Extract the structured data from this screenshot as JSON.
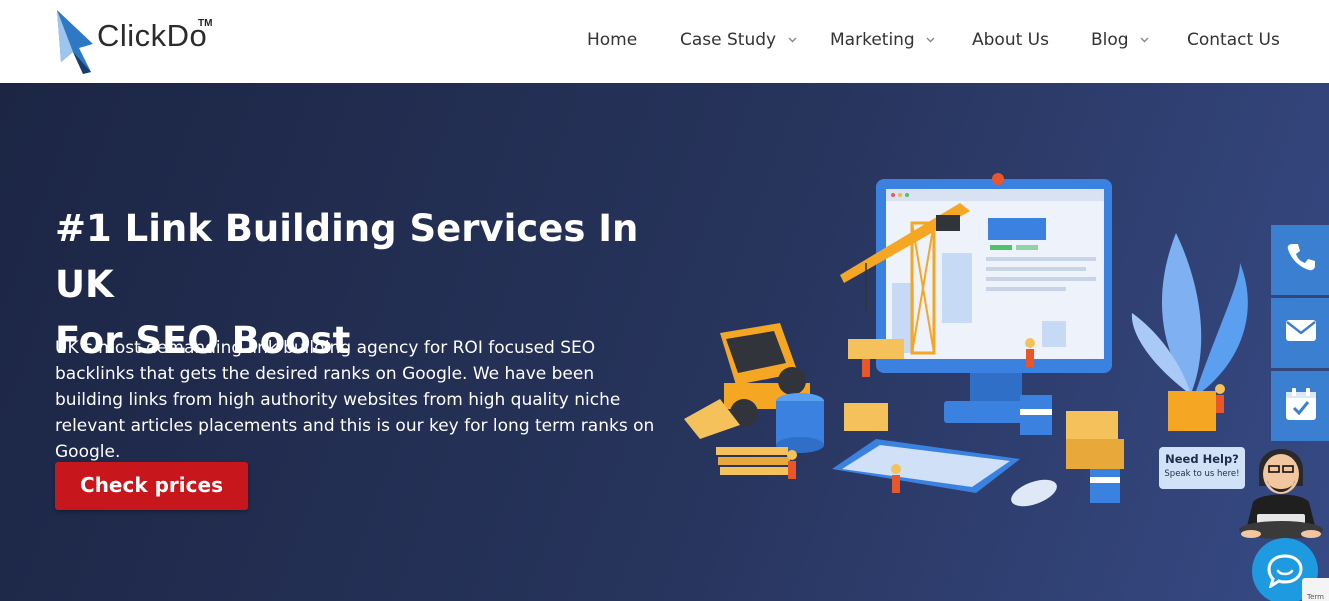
{
  "brand": {
    "name": "ClickDo",
    "trademark": "TM"
  },
  "nav": {
    "items": [
      {
        "label": "Home",
        "has_dropdown": false
      },
      {
        "label": "Case Study",
        "has_dropdown": true
      },
      {
        "label": "Marketing",
        "has_dropdown": true
      },
      {
        "label": "About Us",
        "has_dropdown": false
      },
      {
        "label": "Blog",
        "has_dropdown": true
      },
      {
        "label": "Contact Us",
        "has_dropdown": false
      }
    ]
  },
  "hero": {
    "title_line1": "#1 Link Building Services In UK",
    "title_line2": "For SEO Boost",
    "description": "UK’s most demanding link building agency for ROI focused SEO backlinks that gets the desired ranks on Google. We have been building links from high authority websites from high quality niche relevant articles placements and this is our key for long term ranks on Google.",
    "cta_label": "Check prices"
  },
  "side_widgets": [
    {
      "icon": "phone-icon"
    },
    {
      "icon": "email-icon"
    },
    {
      "icon": "calendar-check-icon"
    }
  ],
  "help": {
    "title": "Need Help?",
    "subtitle": "Speak to us here!"
  },
  "recaptcha": {
    "text": "Term"
  },
  "colors": {
    "accent": "#c8161d",
    "hero_bg": "#1c2544",
    "side_blue": "#3b7fd0",
    "chat_blue": "#1e9be0"
  }
}
